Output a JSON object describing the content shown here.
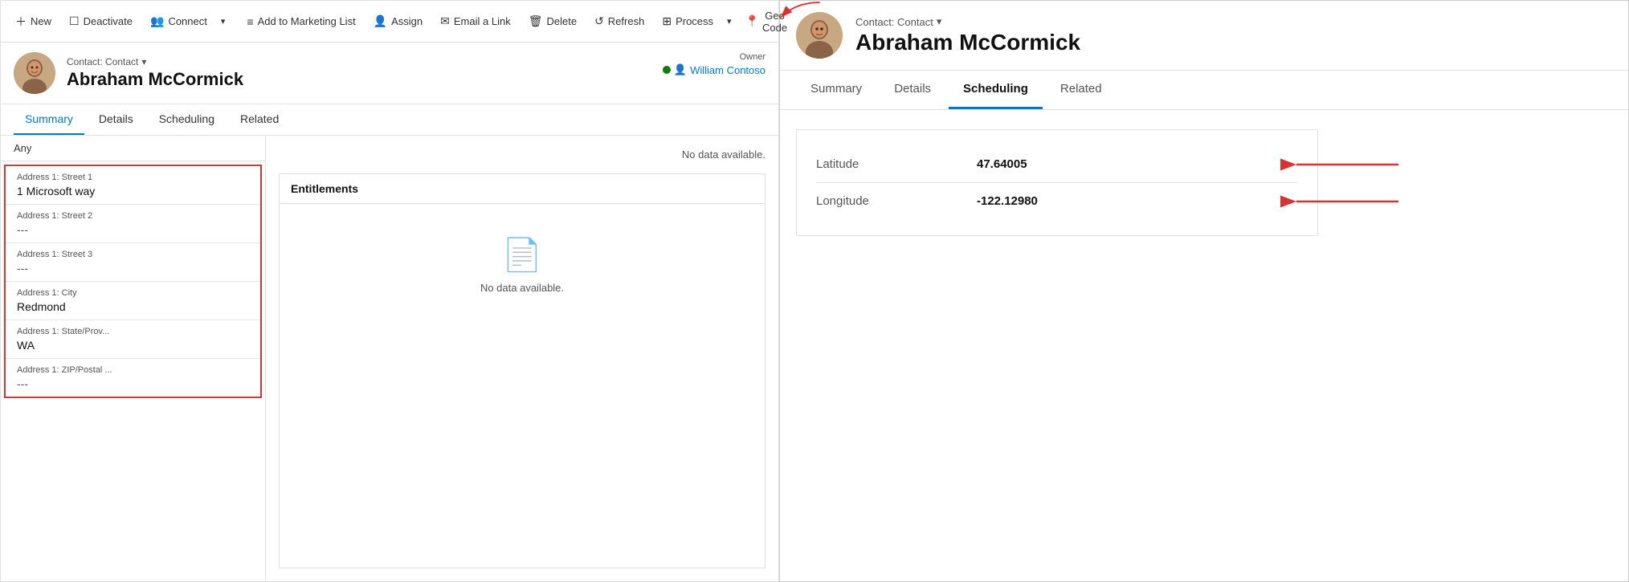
{
  "toolbar": {
    "new_label": "New",
    "deactivate_label": "Deactivate",
    "connect_label": "Connect",
    "add_marketing_label": "Add to Marketing List",
    "assign_label": "Assign",
    "email_link_label": "Email a Link",
    "delete_label": "Delete",
    "refresh_label": "Refresh",
    "process_label": "Process",
    "geocode_label": "Geo Code"
  },
  "left_panel": {
    "contact_type": "Contact: Contact",
    "contact_name": "Abraham McCormick",
    "owner_label": "Owner",
    "owner_name": "William Contoso",
    "tabs": [
      "Summary",
      "Details",
      "Scheduling",
      "Related"
    ],
    "active_tab": "Summary"
  },
  "address": {
    "section_header": "Any",
    "fields": [
      {
        "label": "Address 1: Street 1",
        "value": "1 Microsoft way"
      },
      {
        "label": "Address 1: Street 2",
        "value": "---"
      },
      {
        "label": "Address 1: Street 3",
        "value": "---"
      },
      {
        "label": "Address 1: City",
        "value": "Redmond"
      },
      {
        "label": "Address 1: State/Prov...",
        "value": "WA"
      },
      {
        "label": "Address 1: ZIP/Postal ...",
        "value": "---"
      }
    ]
  },
  "entitlements": {
    "header": "Entitlements",
    "no_data": "No data available.",
    "top_no_data": "No data available."
  },
  "right_panel": {
    "contact_type": "Contact: Contact",
    "contact_name": "Abraham McCormick",
    "tabs": [
      "Summary",
      "Details",
      "Scheduling",
      "Related"
    ],
    "active_tab": "Scheduling",
    "scheduling": {
      "latitude_label": "Latitude",
      "latitude_value": "47.64005",
      "longitude_label": "Longitude",
      "longitude_value": "-122.12980"
    }
  }
}
